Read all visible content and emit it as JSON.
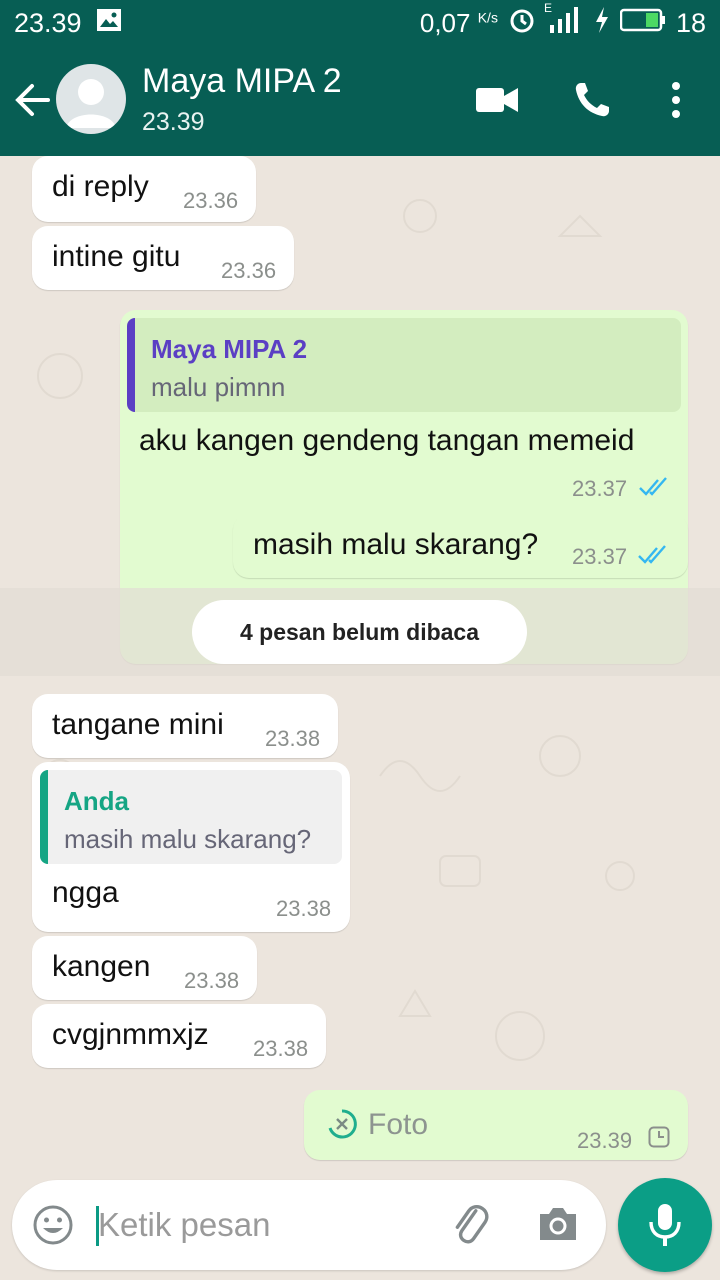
{
  "status_bar": {
    "time": "23.39",
    "network_speed": "0,07",
    "network_unit": "K/s",
    "network_type": "E",
    "battery": "18",
    "icons": [
      "image-icon",
      "alarm-icon",
      "signal-icon",
      "charging-icon",
      "battery-icon"
    ]
  },
  "header": {
    "contact_name": "Maya MIPA 2",
    "last_seen": "23.39",
    "icons": [
      "back-arrow-icon",
      "avatar",
      "video-call-icon",
      "phone-icon",
      "more-vert-icon"
    ]
  },
  "messages": [
    {
      "direction": "in",
      "text": "di reply",
      "time": "23.36"
    },
    {
      "direction": "in",
      "text": "intine gitu",
      "time": "23.36"
    },
    {
      "direction": "out",
      "quote_name": "Maya MIPA 2",
      "quote_text": "malu pimnn",
      "text": "aku kangen gendeng tangan memeid",
      "time": "23.37",
      "status": "read"
    },
    {
      "direction": "out",
      "text": "masih malu skarang?",
      "time": "23.37",
      "status": "read"
    },
    {
      "direction": "in",
      "text": "tangane mini",
      "time": "23.38"
    },
    {
      "direction": "in",
      "quote_name": "Anda",
      "quote_text": "masih malu skarang?",
      "text": "ngga",
      "time": "23.38"
    },
    {
      "direction": "in",
      "text": "kangen",
      "time": "23.38"
    },
    {
      "direction": "in",
      "text": "cvgjnmmxjz",
      "time": "23.38"
    },
    {
      "direction": "out",
      "text": "Foto",
      "time": "23.39",
      "status": "pending"
    }
  ],
  "unread_banner": "4 pesan belum dibaca",
  "input": {
    "placeholder": "Ketik pesan"
  },
  "colors": {
    "header": "#075e54",
    "chat_bg": "#ece5dd",
    "bubble_out": "#e2fbd0",
    "bubble_in": "#ffffff",
    "read_ticks": "#34b7f1",
    "quote_contact": "#5b3fc4",
    "quote_self": "#15a584",
    "mic_button": "#0b9e86"
  }
}
